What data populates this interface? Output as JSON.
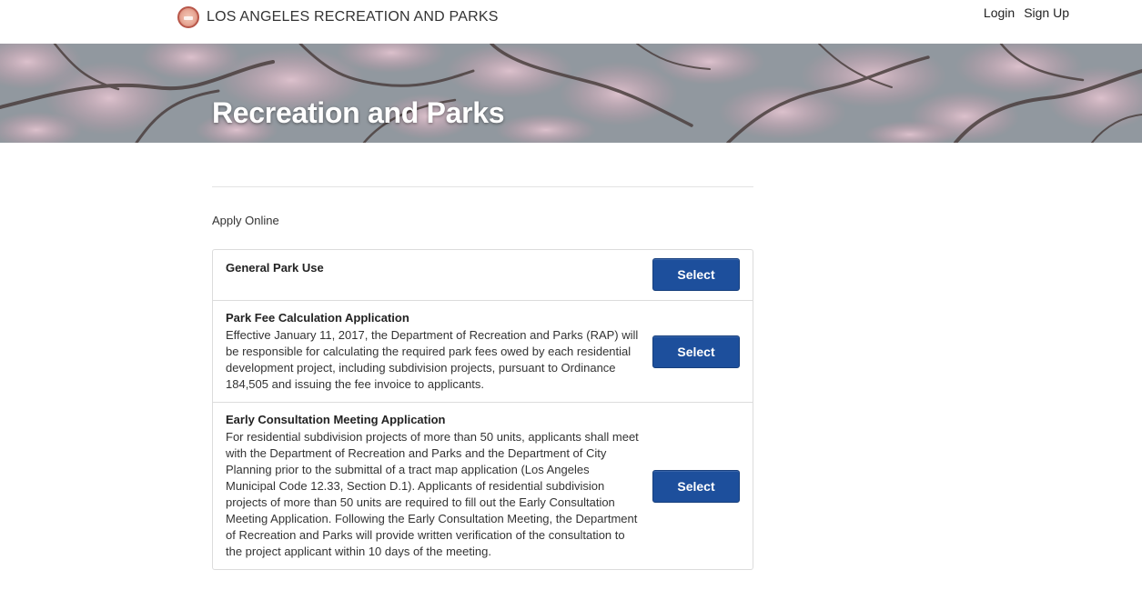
{
  "header": {
    "brand_name": "LOS ANGELES RECREATION AND PARKS",
    "login_label": "Login",
    "signup_label": "Sign Up"
  },
  "hero": {
    "title": "Recreation and Parks"
  },
  "main": {
    "section_label": "Apply Online",
    "applications": [
      {
        "title": "General Park Use",
        "description": "",
        "button_label": "Select"
      },
      {
        "title": "Park Fee Calculation Application",
        "description": "Effective January 11, 2017, the Department of Recreation and Parks (RAP) will be responsible for calculating the required park fees owed by each residential development project, including subdivision projects, pursuant to Ordinance 184,505 and issuing the fee invoice to applicants.",
        "button_label": "Select"
      },
      {
        "title": "Early Consultation Meeting Application",
        "description": "For residential subdivision projects of more than 50 units, applicants shall meet with the Department of Recreation and Parks and the Department of City Planning prior to the submittal of a tract map application (Los Angeles Municipal Code 12.33, Section D.1). Applicants of residential subdivision projects of more than 50 units are required to fill out the Early Consultation Meeting Application. Following the Early Consultation Meeting, the Department of Recreation and Parks will provide written verification of the consultation to the project applicant within 10 days of the meeting.",
        "button_label": "Select"
      }
    ]
  },
  "colors": {
    "primary_button": "#1d4f9c",
    "hero_text": "#ffffff",
    "blossom": "#e7b6c6"
  }
}
